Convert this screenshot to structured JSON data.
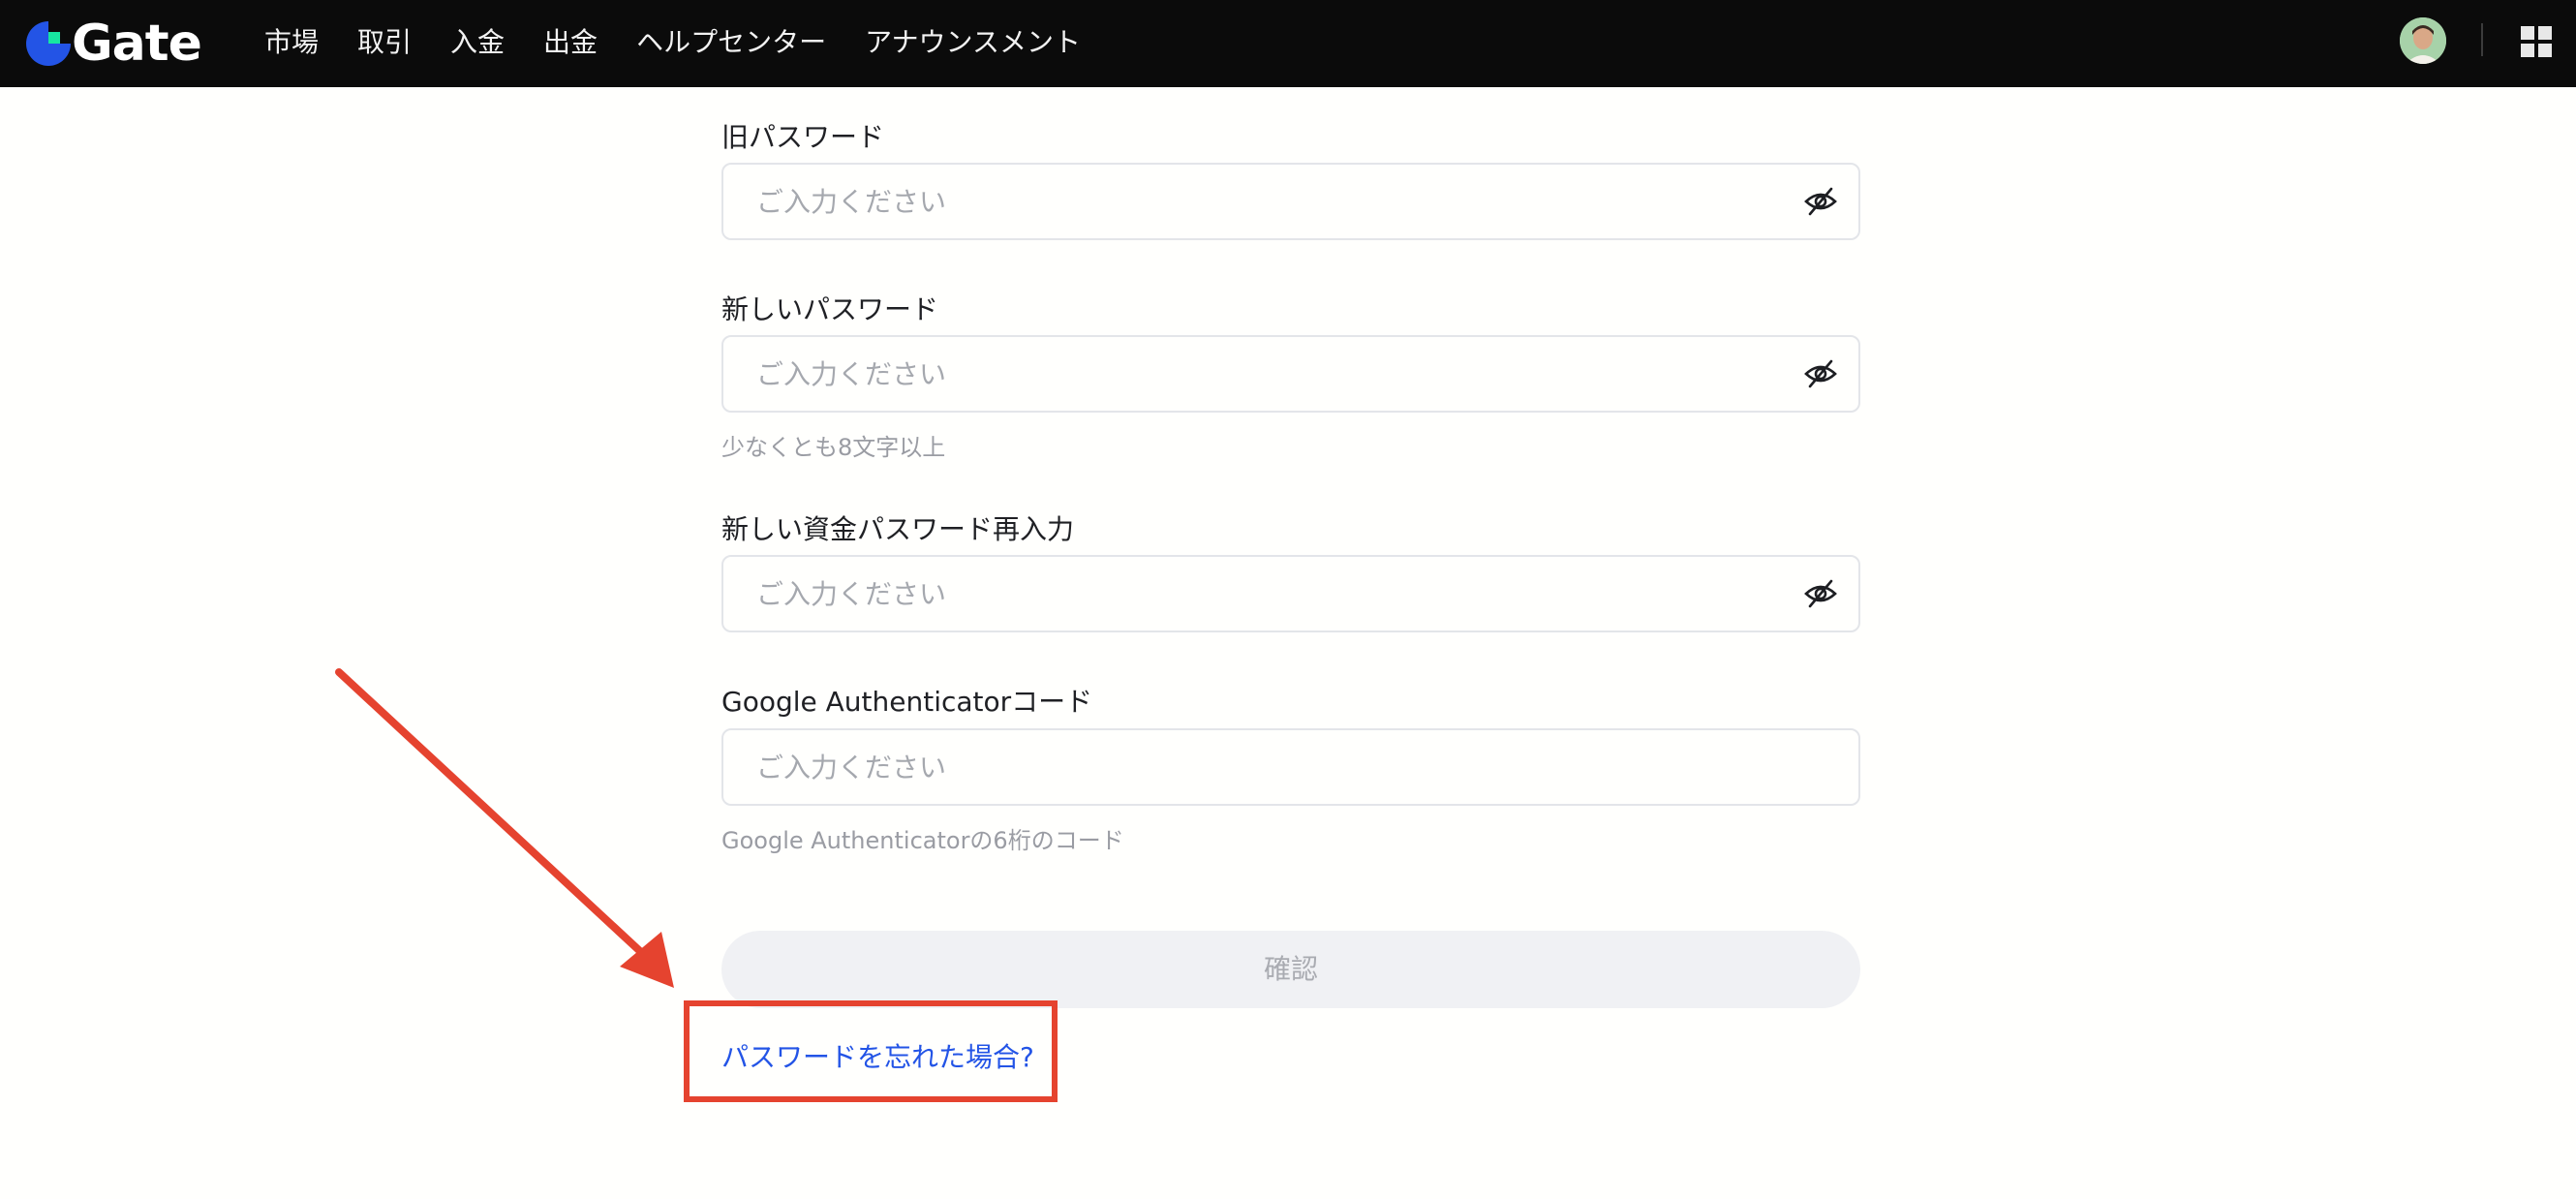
{
  "header": {
    "logo_text": "Gate",
    "nav": [
      "市場",
      "取引",
      "入金",
      "出金",
      "ヘルプセンター",
      "アナウンスメント"
    ]
  },
  "form": {
    "old_password": {
      "label": "旧パスワード",
      "placeholder": "ご入力ください"
    },
    "new_password": {
      "label": "新しいパスワード",
      "placeholder": "ご入力ください",
      "hint": "少なくとも8文字以上"
    },
    "confirm_password": {
      "label": "新しい資金パスワード再入力",
      "placeholder": "ご入力ください"
    },
    "google_auth": {
      "label": "Google Authenticatorコード",
      "placeholder": "ご入力ください",
      "hint": "Google Authenticatorの6桁のコード"
    },
    "confirm_button": "確認",
    "forgot_link": "パスワードを忘れた場合?"
  },
  "colors": {
    "header_bg": "#0b0b0b",
    "link": "#2354e6",
    "annotation": "#e5432f",
    "button_disabled_bg": "#f0f1f4"
  },
  "icons": [
    "gate-logo-icon",
    "avatar",
    "app-grid-icon",
    "eye-off-icon",
    "annotation-arrow"
  ]
}
